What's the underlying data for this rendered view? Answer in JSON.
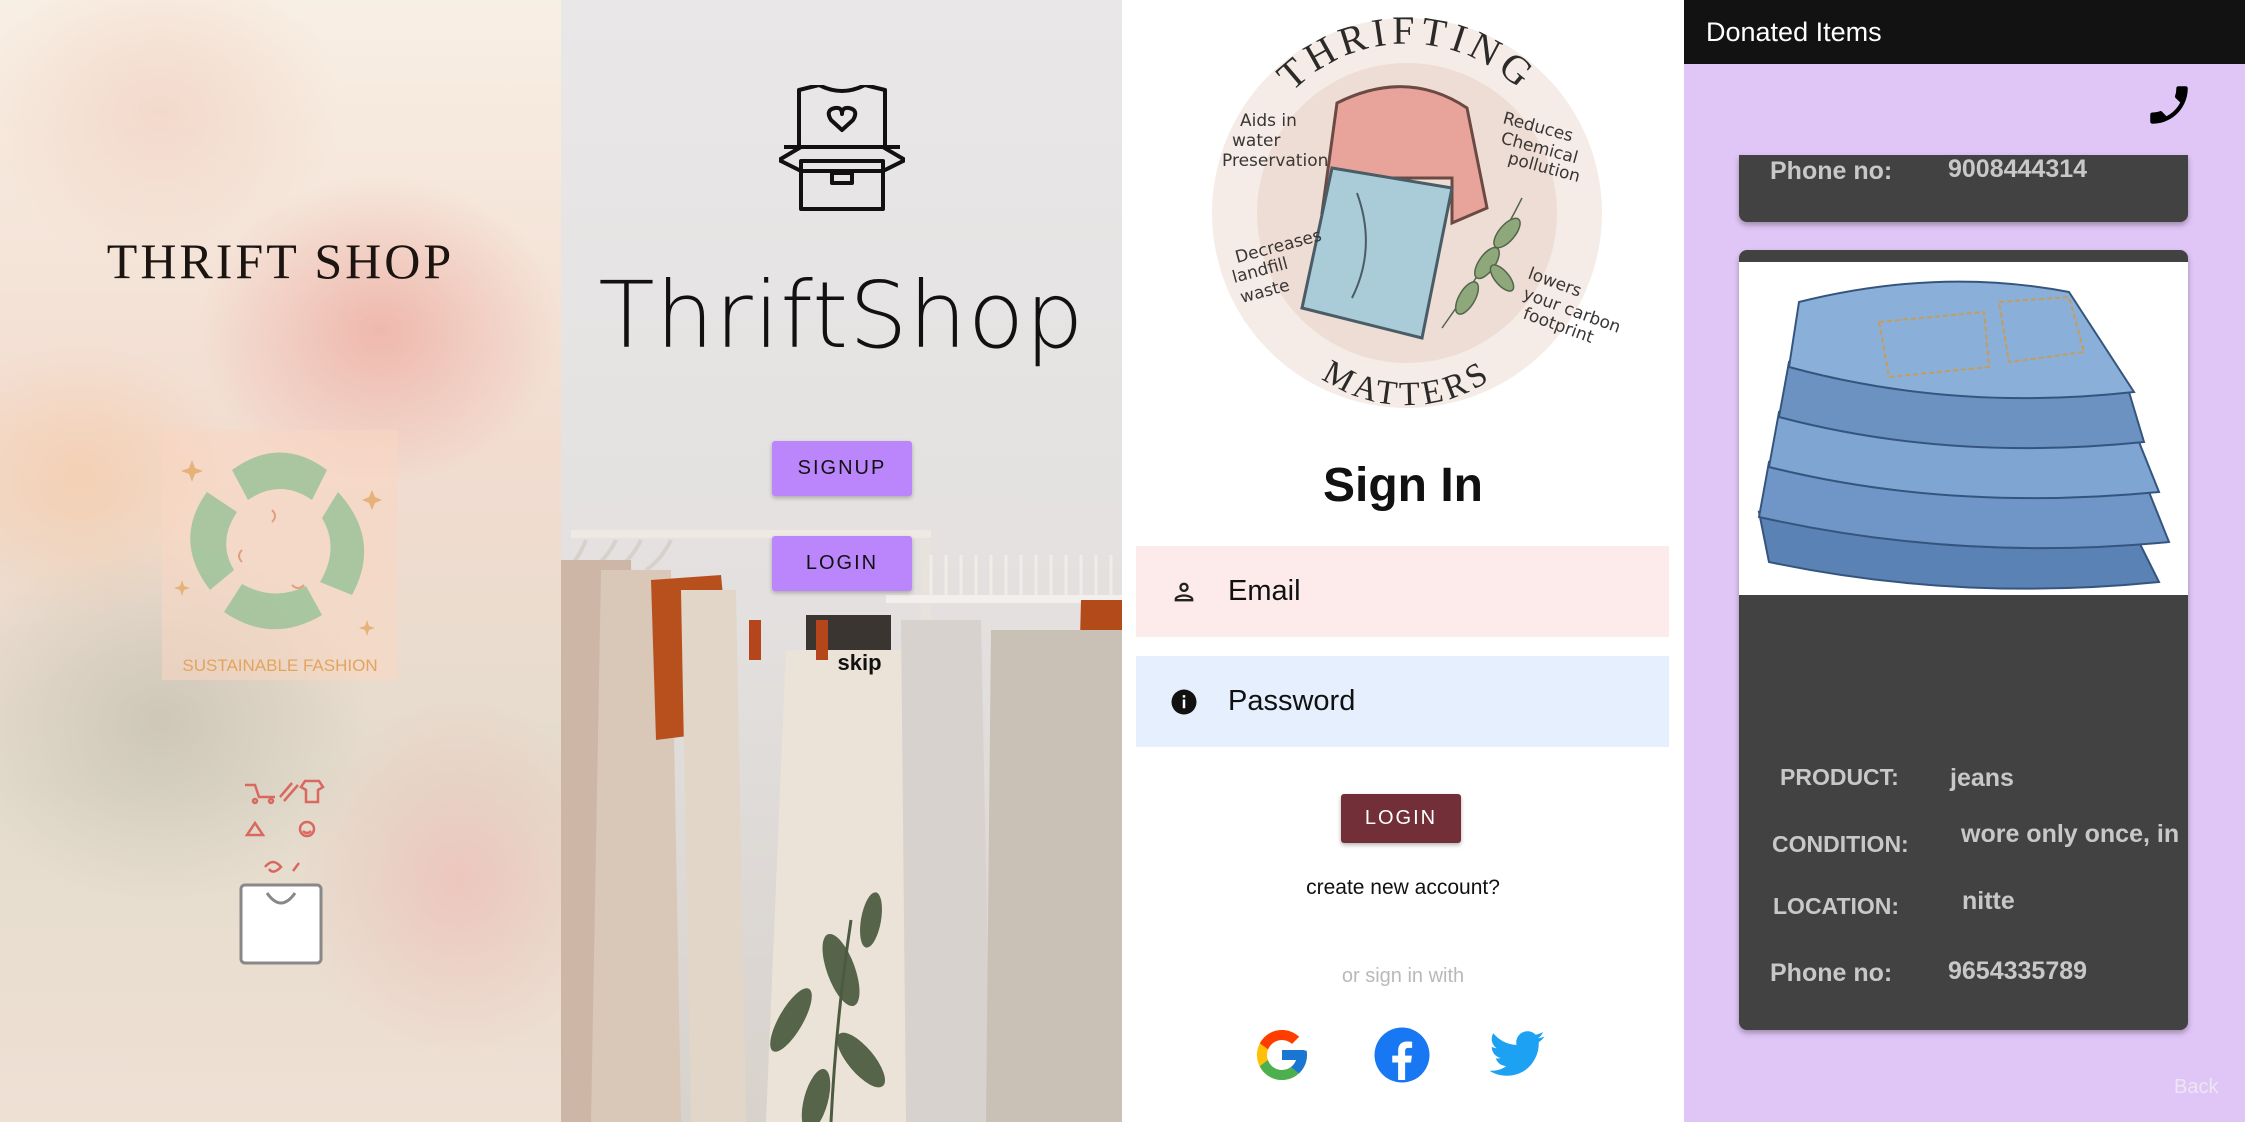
{
  "screen1": {
    "title": "THRIFT SHOP",
    "badge_text": "SUSTAINABLE FASHION"
  },
  "screen2": {
    "title": "ThriftShop",
    "signup_label": "SIGNUP",
    "login_label": "LOGIN",
    "skip_label": "skip"
  },
  "screen3": {
    "logo": {
      "top_text": "THRIFTING",
      "bottom_text": "MATTERS",
      "notes": [
        "Aids in water preservation",
        "Reduces chemical pollution",
        "Decreases landfill waste",
        "lowers your carbon footprint"
      ]
    },
    "title": "Sign In",
    "email_placeholder": "Email",
    "password_placeholder": "Password",
    "login_label": "LOGIN",
    "create_account": "create new account?",
    "or_sign_in_with": "or sign in with",
    "social": [
      "google-icon",
      "facebook-icon",
      "twitter-icon"
    ]
  },
  "screen4": {
    "appbar_title": "Donated Items",
    "top_card": {
      "phone_label": "Phone no:",
      "phone_value": "9008444314"
    },
    "item": {
      "product_label": "PRODUCT:",
      "product_value": "jeans",
      "condition_label": "CONDITION:",
      "condition_value": "wore only once, in",
      "location_label": "LOCATION:",
      "location_value": "nitte",
      "phone_label": "Phone no:",
      "phone_value": "9654335789"
    },
    "back_label": "Back"
  },
  "colors": {
    "purple_button": "#bb86fc",
    "login_dark": "#722f37",
    "email_field": "#fdeaea",
    "password_field": "#e6effd",
    "donated_bg": "#e0c6f7",
    "card_bg": "#424242",
    "appbar_bg": "#121212"
  }
}
